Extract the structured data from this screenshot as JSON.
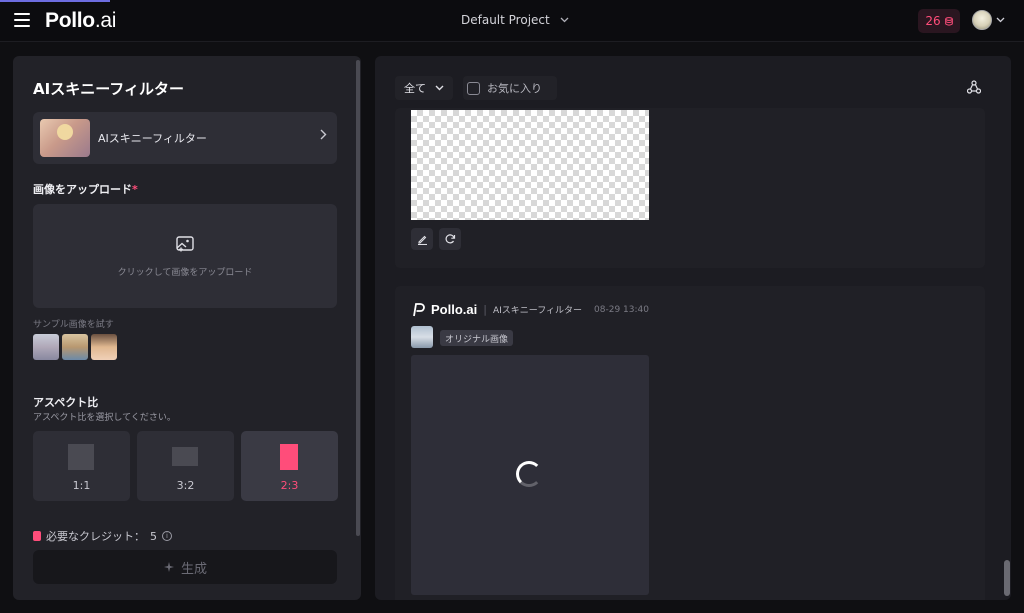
{
  "header": {
    "brand_main": "Pollo",
    "brand_suffix": ".ai",
    "project_name": "Default Project",
    "credits": "26"
  },
  "left_panel": {
    "title": "AIスキニーフィルター",
    "tool_card_label": "AIスキニーフィルター",
    "upload_section_label": "画像をアップロード",
    "required_mark": "*",
    "upload_hint": "クリックして画像をアップロード",
    "sample_label": "サンプル画像を試す",
    "aspect_title": "アスペクト比",
    "aspect_subtitle": "アスペクト比を選択してください。",
    "aspect_options": [
      {
        "label": "1:1",
        "selected": false
      },
      {
        "label": "3:2",
        "selected": false
      },
      {
        "label": "2:3",
        "selected": true
      }
    ],
    "credit_label": "必要なクレジット：",
    "credit_value": "5",
    "generate_label": "生成"
  },
  "right_panel": {
    "filter_value": "全て",
    "favorites_label": "お気に入り",
    "result_card": {
      "brand": "Pollo.ai",
      "separator": "|",
      "tool_name": "AIスキニーフィルター",
      "timestamp": "08-29 13:40",
      "original_tag": "オリジナル画像"
    }
  },
  "colors": {
    "accent_pink": "#ff4d7a",
    "background": "#0f0f12",
    "panel": "#222228"
  }
}
